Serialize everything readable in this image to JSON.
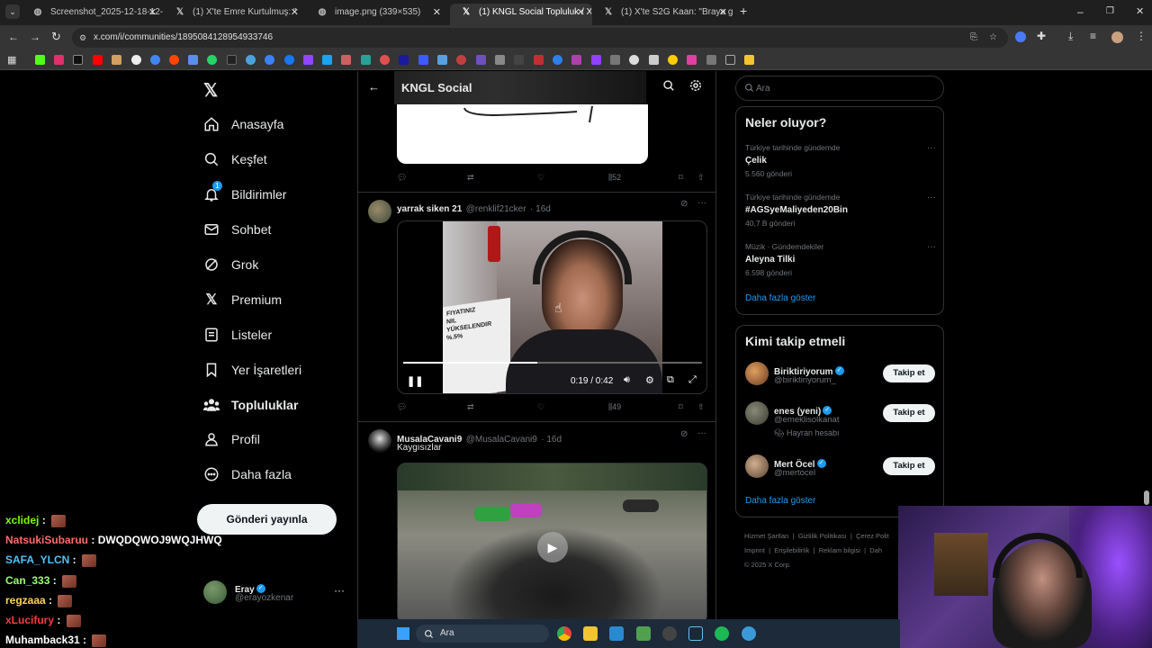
{
  "browser": {
    "tabs": [
      {
        "title": "Screenshot_2025-12-18-12-29-",
        "active": false
      },
      {
        "title": "(1) X'te Emre Kurtulmuş: \"",
        "active": false
      },
      {
        "title": "image.png (339×535)",
        "active": false
      },
      {
        "title": "(1) KNGL Social Topluluk / X",
        "active": true
      },
      {
        "title": "(1) X'te S2G Kaan: \"Braya gün g",
        "active": false
      }
    ],
    "url": "x.com/i/communities/1895084128954933746"
  },
  "nav": {
    "items": [
      {
        "label": "Anasayfa",
        "icon": "home-icon"
      },
      {
        "label": "Keşfet",
        "icon": "search-icon"
      },
      {
        "label": "Bildirimler",
        "icon": "bell-icon",
        "badge": "1"
      },
      {
        "label": "Sohbet",
        "icon": "mail-icon"
      },
      {
        "label": "Grok",
        "icon": "grok-icon"
      },
      {
        "label": "Premium",
        "icon": "x-logo-icon"
      },
      {
        "label": "Listeler",
        "icon": "list-icon"
      },
      {
        "label": "Yer İşaretleri",
        "icon": "bookmark-icon"
      },
      {
        "label": "Topluluklar",
        "icon": "communities-icon"
      },
      {
        "label": "Profil",
        "icon": "person-icon"
      },
      {
        "label": "Daha fazla",
        "icon": "more-circle-icon"
      }
    ],
    "post_button": "Gönderi yayınla",
    "account": {
      "name": "Eray",
      "handle": "@erayozkenar"
    }
  },
  "feed": {
    "header_title": "KNGL Social",
    "post0": {
      "views": "52"
    },
    "post1": {
      "name": "yarrak siken 21",
      "handle": "@renklif21cker",
      "time": "· 16d",
      "video_time": "0:19 / 0:42",
      "progress": 0.45,
      "sign_text": [
        "FIYATINIZ",
        "NIL",
        "YÜKSELENDIR",
        "%.5%"
      ],
      "views": "49"
    },
    "post2": {
      "name": "MusalaCavani9",
      "handle": "@MusalaCavani9",
      "time": "· 16d",
      "text": "Kaygısızlar"
    }
  },
  "right": {
    "search_placeholder": "Ara",
    "trends_title": "Neler oluyor?",
    "trends": [
      {
        "meta": "Türkiye tarihinde gündemde",
        "title": "Çelik",
        "count": "5.560 gönderi"
      },
      {
        "meta": "Türkiye tarihinde gündemde",
        "title": "#AGSyeMaliyeden20Bin",
        "count": "40,7 B gönderi"
      },
      {
        "meta": "Müzik · Gündemdekiler",
        "title": "Aleyna Tilki",
        "count": "6.598 gönderi"
      }
    ],
    "show_more": "Daha fazla göster",
    "follow_title": "Kimi takip etmeli",
    "follow": [
      {
        "name": "Biriktiriyorum",
        "handle": "@biriktiriyorum_",
        "button": "Takip et",
        "extra": ""
      },
      {
        "name": "enes (yeni)",
        "handle": "@emeklisolkanat",
        "button": "Takip et",
        "extra": "Hayran hesabı"
      },
      {
        "name": "Mert Öcel",
        "handle": "@mertocel",
        "button": "Takip et",
        "extra": ""
      }
    ],
    "show_more2": "Daha fazla göster",
    "footer": {
      "line1": [
        "Hizmet Şartları",
        "Gizlilik Politikası",
        "Çerez Polit"
      ],
      "line2": [
        "Imprint",
        "Erişilebilirlik",
        "Reklam bilgisi",
        "Dah"
      ],
      "copyright": "© 2025 X Corp."
    }
  },
  "chat": [
    {
      "user": "xclidej",
      "msg": "",
      "color": "#7CFC00"
    },
    {
      "user": "NatsukiSubaruu",
      "msg": "DWQDQWOJ9WQJHWQ",
      "color": "#FF6B6B"
    },
    {
      "user": "SAFA_YLCN",
      "msg": "",
      "color": "#4FC3F7"
    },
    {
      "user": "Can_333",
      "msg": "",
      "color": "#9CFF6B"
    },
    {
      "user": "regzaaa",
      "msg": "",
      "color": "#FFD54F"
    },
    {
      "user": "xLucifury",
      "msg": "",
      "color": "#FF3B3B"
    },
    {
      "user": "Muhamback31",
      "msg": "",
      "color": "#FFFFFF"
    }
  ],
  "taskbar": {
    "search": "Ara"
  },
  "colors": {
    "accent": "#1d9bf0",
    "background": "#000000",
    "border": "#2f3336"
  }
}
